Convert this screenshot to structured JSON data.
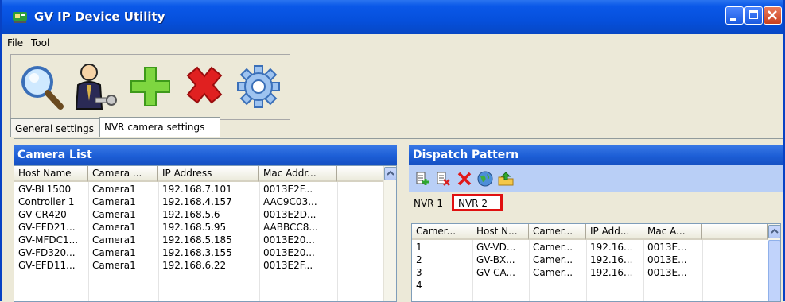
{
  "window": {
    "title": "GV IP Device Utility",
    "accent": "#0a58e8"
  },
  "menu": {
    "items": [
      "File",
      "Tool"
    ]
  },
  "toolbar": {
    "buttons": [
      {
        "icon": "search-icon"
      },
      {
        "icon": "user-key-icon"
      },
      {
        "icon": "add-icon"
      },
      {
        "icon": "delete-icon"
      },
      {
        "icon": "gear-icon"
      }
    ]
  },
  "tabs": {
    "general": "General settings",
    "nvr": "NVR camera settings"
  },
  "camera_list": {
    "title": "Camera List",
    "columns": [
      "Host Name",
      "Camera ...",
      "IP Address",
      "Mac Addr..."
    ],
    "rows": [
      [
        "GV-BL1500",
        "Camera1",
        "192.168.7.101",
        "0013E2F..."
      ],
      [
        "Controller 1",
        "Camera1",
        "192.168.4.157",
        "AAC9C03..."
      ],
      [
        "GV-CR420",
        "Camera1",
        "192.168.5.6",
        "0013E2D..."
      ],
      [
        "GV-EFD21...",
        "Camera1",
        "192.168.5.95",
        "AABBCC8..."
      ],
      [
        "GV-MFDC1...",
        "Camera1",
        "192.168.5.185",
        "0013E20..."
      ],
      [
        "GV-FD320...",
        "Camera1",
        "192.168.3.155",
        "0013E20..."
      ],
      [
        "GV-EFD11...",
        "Camera1",
        "192.168.6.22",
        "0013E2F..."
      ]
    ]
  },
  "dispatch": {
    "title": "Dispatch Pattern",
    "tools": [
      "add-green-icon",
      "remove-red-icon",
      "delete-x-icon",
      "globe-icon",
      "export-icon"
    ],
    "subtabs": [
      "NVR 1",
      "NVR 2"
    ],
    "highlight_color": "#e01010",
    "columns": [
      "Camer...",
      "Host N...",
      "Camer...",
      "IP Add...",
      "Mac A..."
    ],
    "rows": [
      [
        "1",
        "GV-VD...",
        "Camer...",
        "192.16...",
        "0013E..."
      ],
      [
        "2",
        "GV-BX...",
        "Camer...",
        "192.16...",
        "0013E..."
      ],
      [
        "3",
        "GV-CA...",
        "Camer...",
        "192.16...",
        "0013E..."
      ],
      [
        "4",
        "",
        "",
        "",
        ""
      ]
    ]
  }
}
